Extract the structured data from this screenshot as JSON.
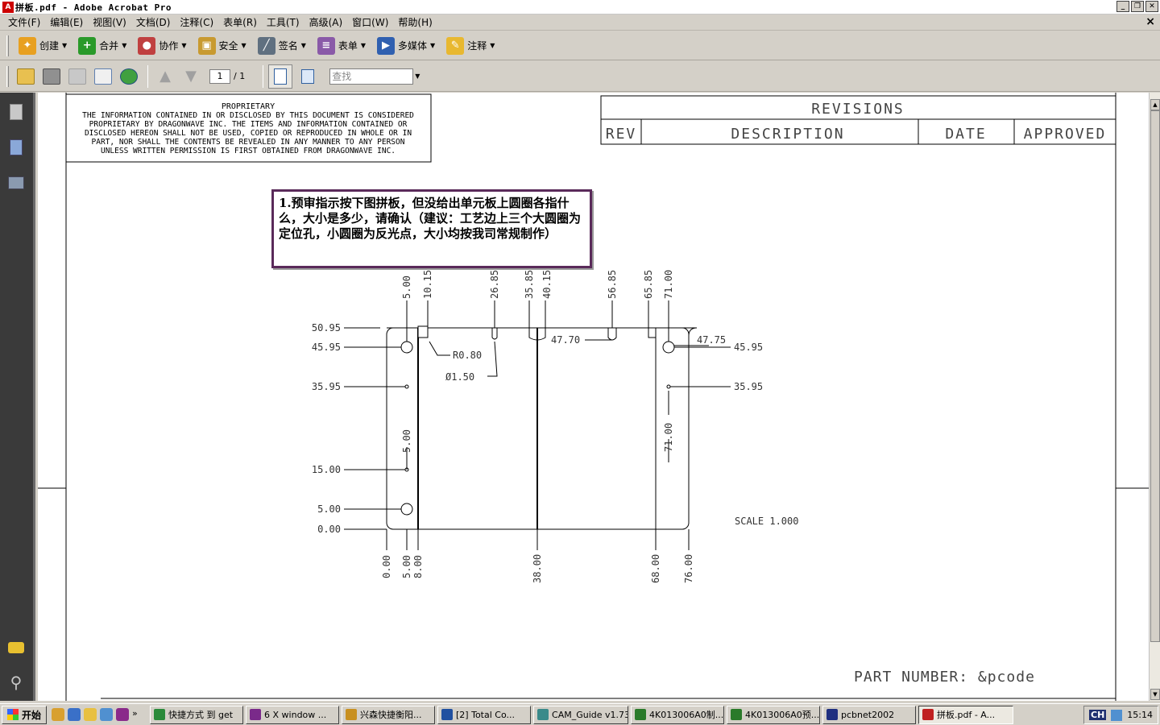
{
  "window": {
    "title": "拼板.pdf - Adobe Acrobat Pro"
  },
  "menu": [
    "文件(F)",
    "编辑(E)",
    "视图(V)",
    "文档(D)",
    "注释(C)",
    "表单(R)",
    "工具(T)",
    "高级(A)",
    "窗口(W)",
    "帮助(H)"
  ],
  "menu_close": "×",
  "toolbar1": [
    {
      "label": "创建",
      "icon": "create-pdf-icon",
      "color": "#e8a020"
    },
    {
      "label": "合并",
      "icon": "combine-files-icon",
      "color": "#2a9a2a"
    },
    {
      "label": "协作",
      "icon": "collaborate-icon",
      "color": "#c04040"
    },
    {
      "label": "安全",
      "icon": "lock-icon",
      "color": "#c89a30"
    },
    {
      "label": "签名",
      "icon": "pen-icon",
      "color": "#607080"
    },
    {
      "label": "表单",
      "icon": "form-icon",
      "color": "#8a5aa8"
    },
    {
      "label": "多媒体",
      "icon": "multimedia-icon",
      "color": "#3060b0"
    },
    {
      "label": "注释",
      "icon": "comment-icon",
      "color": "#e8b830"
    }
  ],
  "toolbar2": {
    "page_current": "1",
    "page_total": "/ 1",
    "search_placeholder": "查找"
  },
  "document": {
    "proprietary_title": "PROPRIETARY",
    "proprietary_lines": [
      "THE INFORMATION CONTAINED IN OR DISCLOSED BY THIS DOCUMENT IS CONSIDERED",
      "PROPRIETARY BY DRAGONWAVE INC. THE ITEMS AND INFORMATION CONTAINED OR",
      "DISCLOSED HEREON SHALL NOT BE USED, COPIED OR REPRODUCED IN WHOLE OR IN",
      "PART, NOR SHALL THE CONTENTS BE REVEALED IN ANY MANNER TO ANY PERSON",
      "UNLESS WRITTEN PERMISSION IS FIRST OBTAINED FROM DRAGONWAVE INC."
    ],
    "revisions": {
      "title": "REVISIONS",
      "rev": "REV",
      "description": "DESCRIPTION",
      "date": "DATE",
      "approved": "APPROVED"
    },
    "note": "1.预审指示按下图拼板，但没给出单元板上圆圈各指什么，大小是多少，请确认（建议：工艺边上三个大圆圈为定位孔，小圆圈为反光点，大小均按我司常规制作）",
    "top_dims": [
      "5.00",
      "10.15",
      "26.85",
      "35.85",
      "40.15",
      "56.85",
      "65.85",
      "71.00"
    ],
    "left_dims": [
      "50.95",
      "45.95",
      "35.95",
      "15.00",
      "5.00",
      "0.00"
    ],
    "bottom_dims": [
      "0.00",
      "5.00",
      "8.00",
      "38.00",
      "68.00",
      "76.00"
    ],
    "right_dims": [
      "45.95",
      "35.95"
    ],
    "inner_dims": {
      "a": "47.70",
      "b": "47.75",
      "c": "R0.80",
      "d": "Ø1.50",
      "e": "5.00",
      "f": "71.00"
    },
    "scale": "SCALE  1.000",
    "part_number": "PART NUMBER: &pcode"
  },
  "taskbar": {
    "start": "开始",
    "tasks": [
      {
        "label": "快捷方式 到 get",
        "color": "#2a8a3a"
      },
      {
        "label": "6 X window ...",
        "color": "#7a2a8a"
      },
      {
        "label": "兴森快捷衡阳...",
        "color": "#c89020"
      },
      {
        "label": "[2] Total Co...",
        "color": "#2050a0"
      },
      {
        "label": "CAM_Guide v1.73",
        "color": "#3a8a8a"
      },
      {
        "label": "4K013006A0制...",
        "color": "#2a7a2a"
      },
      {
        "label": "4K013006A0预...",
        "color": "#2a7a2a"
      },
      {
        "label": "pcbnet2002",
        "color": "#203080"
      },
      {
        "label": "拼板.pdf - A...",
        "color": "#c02020"
      }
    ],
    "lang": "CH",
    "time": "15:14"
  }
}
